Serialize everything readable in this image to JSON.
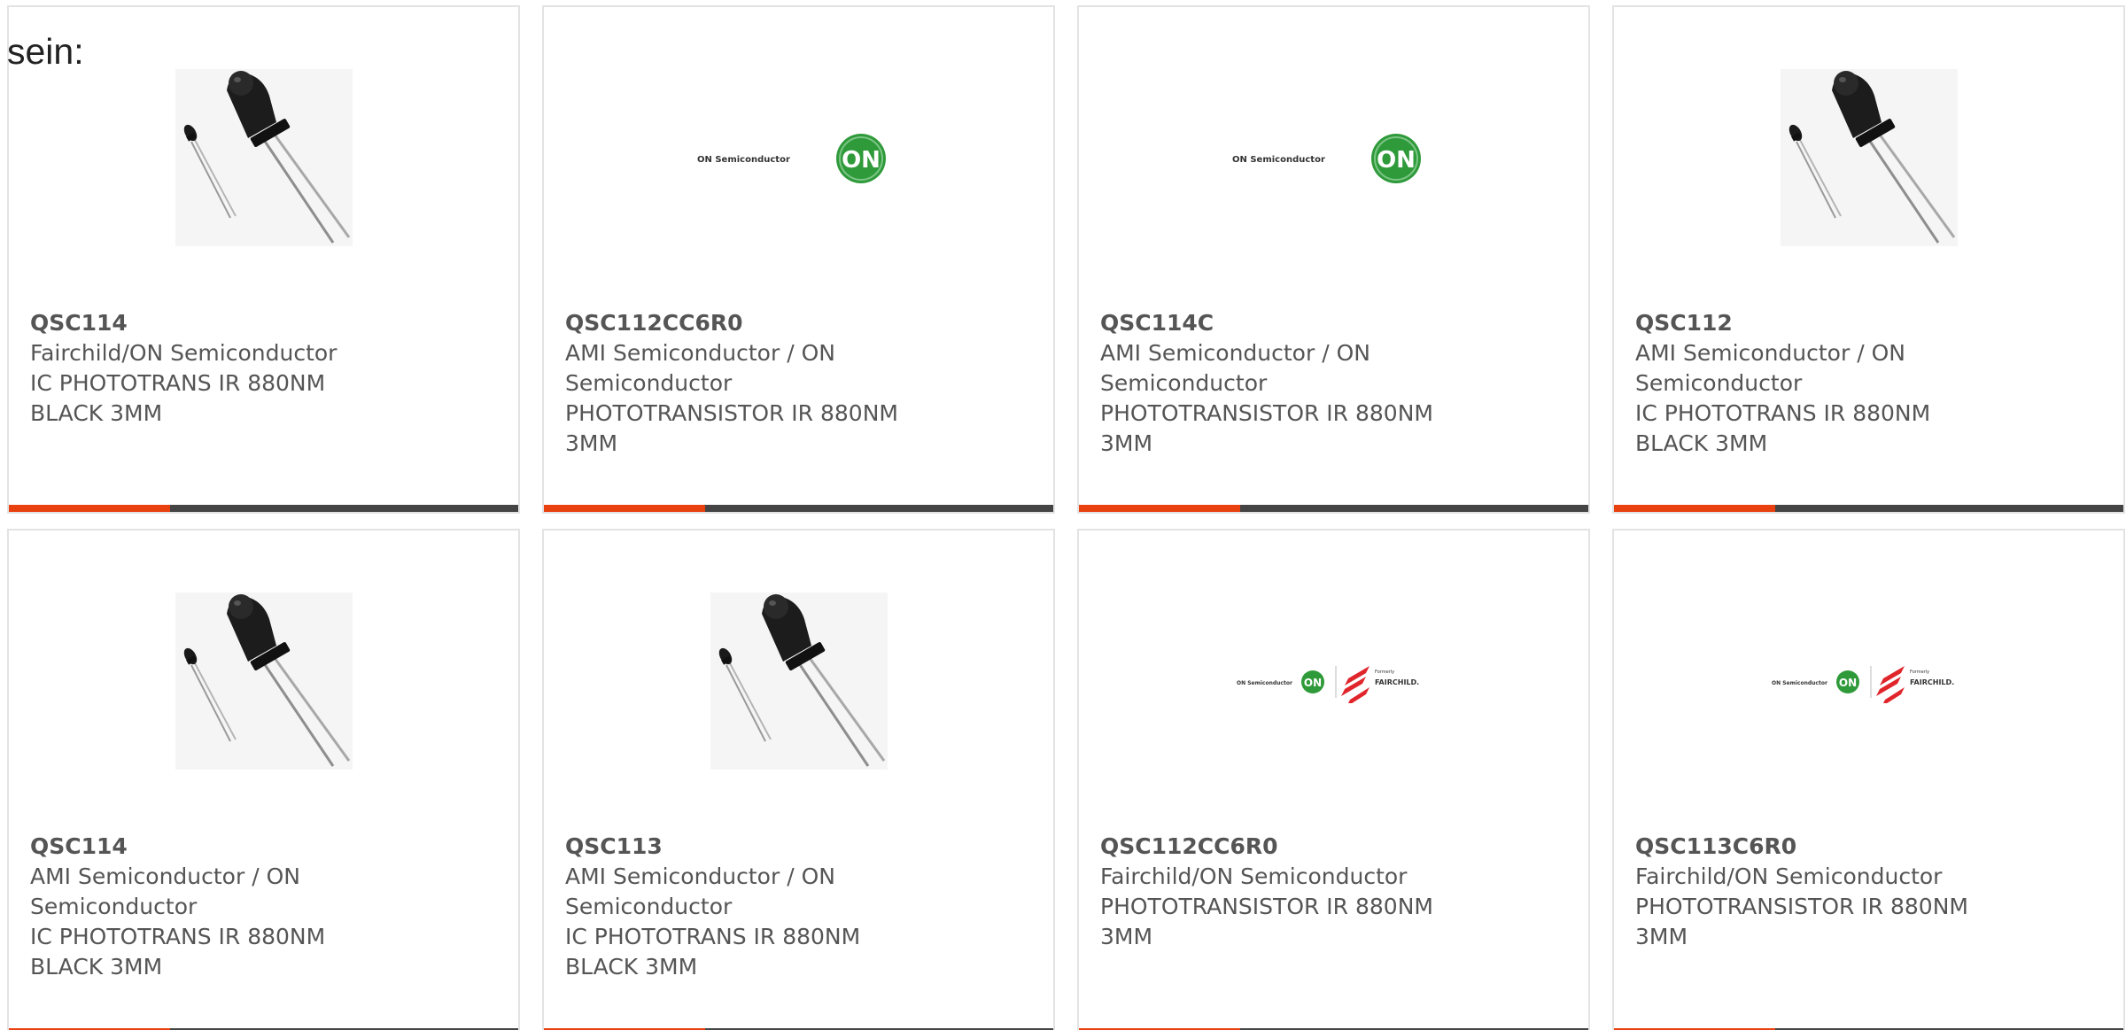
{
  "intro_text": "sein:",
  "colors": {
    "accent": "#e8400f",
    "bar": "#444444",
    "text": "#555555",
    "on_green": "#2f9a3a",
    "fairchild_red": "#e0252b"
  },
  "products": [
    {
      "part_number": "QSC114",
      "manufacturer_lines": [
        "Fairchild/ON Semiconductor"
      ],
      "description_lines": [
        "IC PHOTOTRANS IR 880NM",
        "BLACK 3MM"
      ],
      "image": "phototransistor-photo"
    },
    {
      "part_number": "QSC112CC6R0",
      "manufacturer_lines": [
        "AMI Semiconductor / ON",
        "Semiconductor"
      ],
      "description_lines": [
        "PHOTOTRANSISTOR IR 880NM",
        "3MM"
      ],
      "image": "on-semiconductor-logo",
      "logo_text": "ON Semiconductor",
      "logo_badge": "ON"
    },
    {
      "part_number": "QSC114C",
      "manufacturer_lines": [
        "AMI Semiconductor / ON",
        "Semiconductor"
      ],
      "description_lines": [
        "PHOTOTRANSISTOR IR 880NM",
        "3MM"
      ],
      "image": "on-semiconductor-logo",
      "logo_text": "ON Semiconductor",
      "logo_badge": "ON"
    },
    {
      "part_number": "QSC112",
      "manufacturer_lines": [
        "AMI Semiconductor / ON",
        "Semiconductor"
      ],
      "description_lines": [
        "IC PHOTOTRANS IR 880NM",
        "BLACK 3MM"
      ],
      "image": "phototransistor-photo"
    },
    {
      "part_number": "QSC114",
      "manufacturer_lines": [
        "AMI Semiconductor / ON",
        "Semiconductor"
      ],
      "description_lines": [
        "IC PHOTOTRANS IR 880NM",
        "BLACK 3MM"
      ],
      "image": "phototransistor-photo"
    },
    {
      "part_number": "QSC113",
      "manufacturer_lines": [
        "AMI Semiconductor / ON",
        "Semiconductor"
      ],
      "description_lines": [
        "IC PHOTOTRANS IR 880NM",
        "BLACK 3MM"
      ],
      "image": "phototransistor-photo"
    },
    {
      "part_number": "QSC112CC6R0",
      "manufacturer_lines": [
        "Fairchild/ON Semiconductor"
      ],
      "description_lines": [
        "PHOTOTRANSISTOR IR 880NM",
        "3MM"
      ],
      "image": "on-fairchild-logo",
      "logo_text": "ON Semiconductor",
      "logo_badge": "ON",
      "logo_sub": "Formerly",
      "logo_brand": "FAIRCHILD."
    },
    {
      "part_number": "QSC113C6R0",
      "manufacturer_lines": [
        "Fairchild/ON Semiconductor"
      ],
      "description_lines": [
        "PHOTOTRANSISTOR IR 880NM",
        "3MM"
      ],
      "image": "on-fairchild-logo",
      "logo_text": "ON Semiconductor",
      "logo_badge": "ON",
      "logo_sub": "Formerly",
      "logo_brand": "FAIRCHILD."
    }
  ]
}
